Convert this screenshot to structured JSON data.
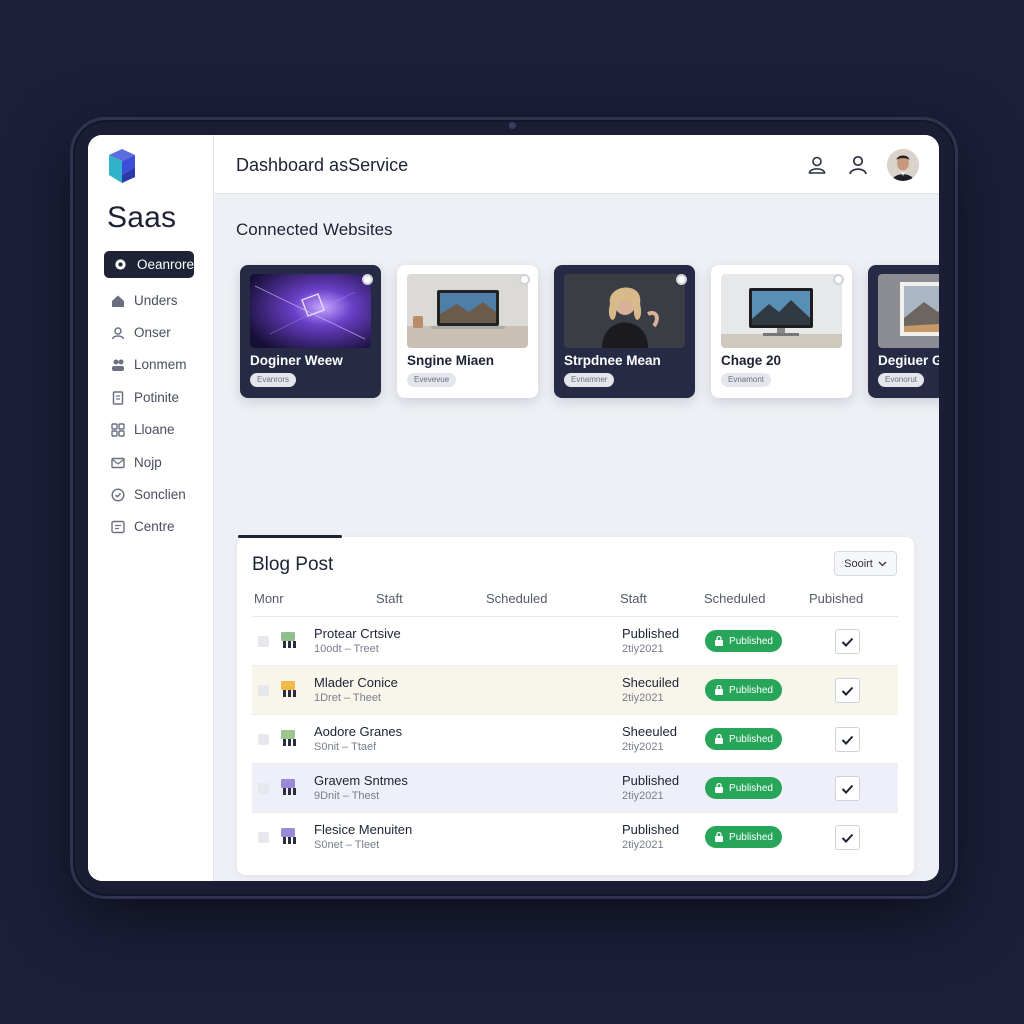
{
  "sidebar": {
    "brand": "Saas",
    "items": [
      {
        "label": "Oeanrore",
        "icon": "gear-icon",
        "active": true
      },
      {
        "label": "Unders",
        "icon": "home-icon"
      },
      {
        "label": "Onser",
        "icon": "user-icon"
      },
      {
        "label": "Lonmem",
        "icon": "users-icon"
      },
      {
        "label": "Potinite",
        "icon": "document-icon"
      },
      {
        "label": "Lloane",
        "icon": "grid-icon"
      },
      {
        "label": "Nojp",
        "icon": "mail-icon"
      },
      {
        "label": "Sonclien",
        "icon": "check-circle-icon"
      },
      {
        "label": "Centre",
        "icon": "list-icon"
      }
    ]
  },
  "header": {
    "title": "Dashboard asService",
    "icons": [
      "user-outline-icon",
      "profile-icon"
    ]
  },
  "connected": {
    "title": "Connected Websites",
    "cards": [
      {
        "title": "Doginer Weew",
        "tag": "Evanrors",
        "theme": "dark",
        "thumb": "purple-nebula"
      },
      {
        "title": "Sngine Miaen",
        "tag": "Evevevue",
        "theme": "light",
        "thumb": "laptop-desk"
      },
      {
        "title": "Strpdnee Mean",
        "tag": "Evnamner",
        "theme": "dark",
        "thumb": "portrait"
      },
      {
        "title": "Chage 20",
        "tag": "Evnamont",
        "theme": "light",
        "thumb": "monitor-mountain"
      },
      {
        "title": "Degiuer Gloa",
        "tag": "Evonorut",
        "theme": "dark",
        "thumb": "framed-landscape"
      }
    ]
  },
  "blog": {
    "title": "Blog Post",
    "sort_label": "Sooirt",
    "columns": [
      "Monr",
      "Staft",
      "Scheduled",
      "Staft",
      "Scheduled",
      "Pubished"
    ],
    "rows": [
      {
        "title": "Protear Crtsive",
        "sub": "10odt – Treet",
        "status": "Published",
        "date": "2tiy2021",
        "badge": "Published",
        "icon_color": "#8fbf8a"
      },
      {
        "title": "Mlader Conice",
        "sub": "1Dret – Theet",
        "status": "Shecuiled",
        "date": "2tiy2021",
        "badge": "Published",
        "icon_color": "#f0b94a"
      },
      {
        "title": "Aodore Granes",
        "sub": "S0nit – Ttaef",
        "status": "Sheeuled",
        "date": "2tiy2021",
        "badge": "Published",
        "icon_color": "#9fc58f"
      },
      {
        "title": "Gravem Sntmes",
        "sub": "9Dnit – Thest",
        "status": "Published",
        "date": "2tiy2021",
        "badge": "Published",
        "icon_color": "#9a88d8"
      },
      {
        "title": "Flesice Menuiten",
        "sub": "S0net – Tleet",
        "status": "Published",
        "date": "2tiy2021",
        "badge": "Published",
        "icon_color": "#9a88d8"
      }
    ]
  },
  "colors": {
    "accent": "#1f2336",
    "success": "#27a65a",
    "background": "#1c1f3a"
  }
}
